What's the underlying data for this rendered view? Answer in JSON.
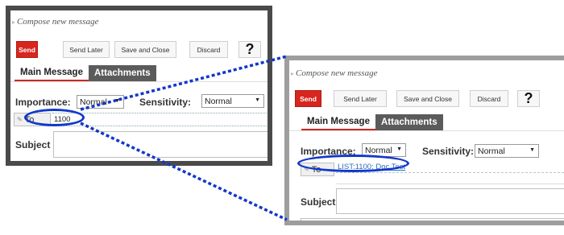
{
  "compose_title": "Compose new message",
  "toolbar": {
    "send_label": "Send",
    "send_later_label": "Send Later",
    "save_close_label": "Save and Close",
    "discard_label": "Discard",
    "help_label": "?"
  },
  "tabs": {
    "main_message": "Main Message",
    "attachments": "Attachments"
  },
  "importance": {
    "label": "Importance:",
    "value": "Normal"
  },
  "sensitivity": {
    "label": "Sensitivity:",
    "value": "Normal"
  },
  "to_button_label": "To",
  "subject_label": "Subject",
  "panel_a": {
    "to_value": "1100"
  },
  "panel_b": {
    "to_value": "LIST:1100: Doc Test"
  },
  "colors": {
    "send": "#d7261e",
    "highlight": "#1237c8",
    "tab_inactive": "#5b5b5b"
  },
  "icons": {
    "title_arrow": "arrow-icon",
    "to_button": "pencil-icon",
    "caret": "caret-down-icon"
  }
}
